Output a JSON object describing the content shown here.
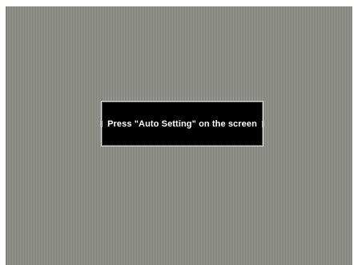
{
  "osd": {
    "message": "Press \"Auto Setting\" on the screen"
  },
  "colors": {
    "screen_light_line": "#9a9a93",
    "screen_dark_line": "#7e7e78",
    "osd_background": "#000000",
    "osd_text": "#ffffff",
    "left_edge": "#c46a6a"
  }
}
